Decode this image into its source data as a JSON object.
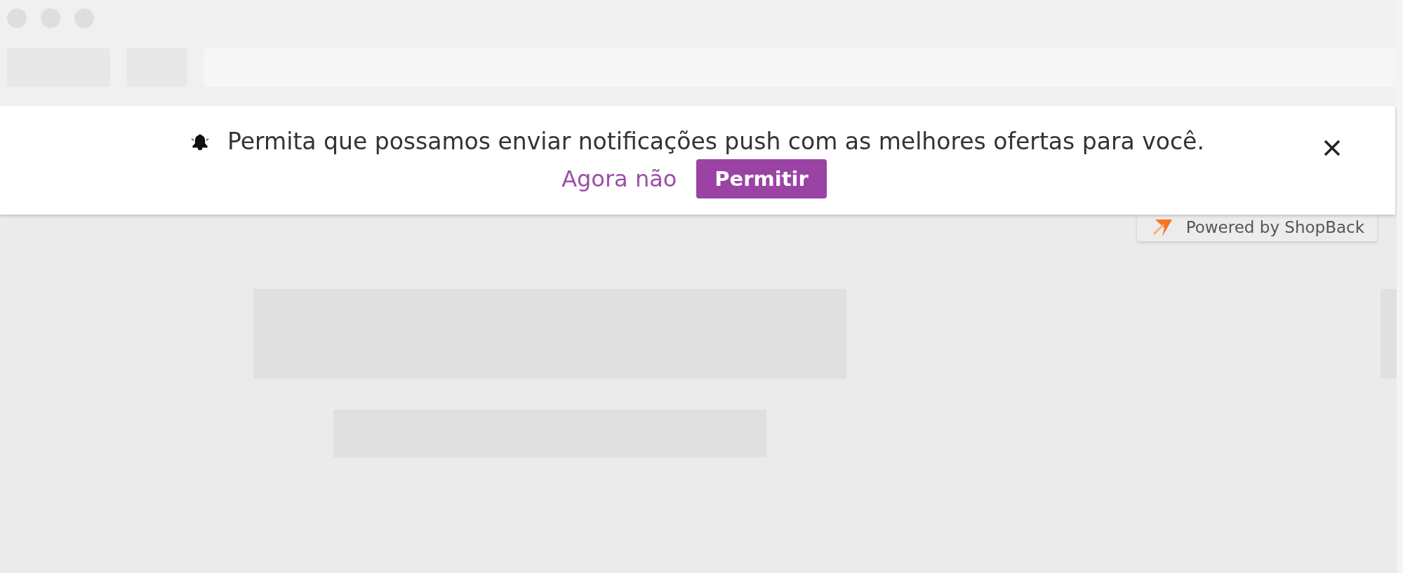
{
  "notification": {
    "message": "Permita que possamos enviar notificações push com as melhores ofertas para você.",
    "dismiss_link": "Agora não",
    "allow_button": "Permitir"
  },
  "badge": {
    "text": "Powered by ShopBack"
  }
}
